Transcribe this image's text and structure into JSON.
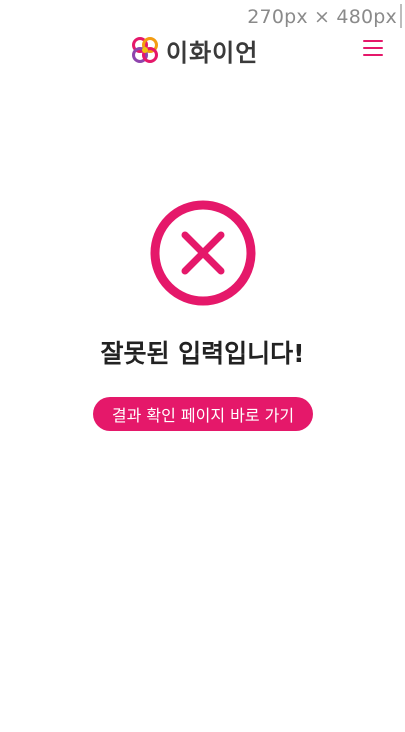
{
  "viewport_label": "270px × 480px",
  "header": {
    "logo_text": "이화이언",
    "logo_icon": "ewhaian-logo-icon",
    "menu_icon": "hamburger-menu-icon"
  },
  "main": {
    "status_icon": "x-circle-icon",
    "title": "잘못된 입력입니다!",
    "button_label": "결과 확인 페이지 바로 가기"
  },
  "colors": {
    "accent": "#e5186a",
    "text": "#222222",
    "background": "#ffffff"
  }
}
